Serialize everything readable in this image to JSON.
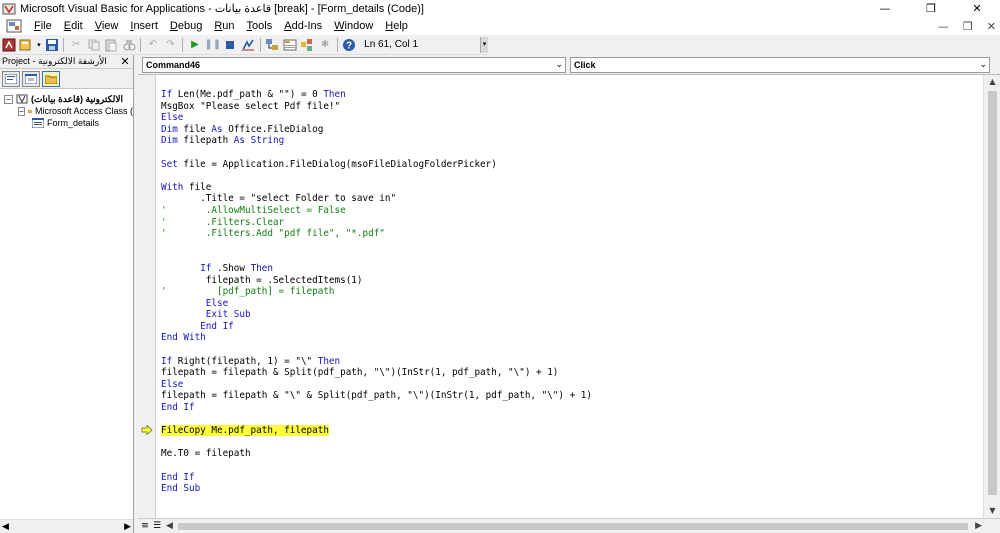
{
  "window": {
    "title": "Microsoft Visual Basic for Applications - قاعدة بيانات [break] - [Form_details (Code)]",
    "minimize": "—",
    "maximize": "❐",
    "close": "✕"
  },
  "menu": {
    "items": [
      {
        "pre": "",
        "u": "F",
        "post": "ile"
      },
      {
        "pre": "",
        "u": "E",
        "post": "dit"
      },
      {
        "pre": "",
        "u": "V",
        "post": "iew"
      },
      {
        "pre": "",
        "u": "I",
        "post": "nsert"
      },
      {
        "pre": "",
        "u": "D",
        "post": "ebug"
      },
      {
        "pre": "",
        "u": "R",
        "post": "un"
      },
      {
        "pre": "",
        "u": "T",
        "post": "ools"
      },
      {
        "pre": "",
        "u": "A",
        "post": "dd-Ins"
      },
      {
        "pre": "",
        "u": "W",
        "post": "indow"
      },
      {
        "pre": "",
        "u": "H",
        "post": "elp"
      }
    ],
    "mdi_minimize": "—",
    "mdi_restore": "❐",
    "mdi_close": "✕"
  },
  "toolbar": {
    "cursor_position": "Ln 61, Col 1"
  },
  "project": {
    "title": "Project - الأرشفة الالكترونية",
    "close": "✕",
    "tree": [
      {
        "label": "الالكترونية (قاعدة بيانات)",
        "level": 0
      },
      {
        "label": "Microsoft Access Class (",
        "level": 1
      },
      {
        "label": "Form_details",
        "level": 2
      }
    ]
  },
  "code_window": {
    "object_combo": "Command46",
    "procedure_combo": "Click",
    "current_line_index": 29,
    "lines": [
      [
        {
          "t": "If",
          "c": "kw"
        },
        {
          "t": " Len(Me.pdf_path & \"\") = 0 "
        },
        {
          "t": "Then",
          "c": "kw"
        }
      ],
      [
        {
          "t": "MsgBox \"Please select Pdf file!\""
        }
      ],
      [
        {
          "t": "Else",
          "c": "kw"
        }
      ],
      [
        {
          "t": "Dim",
          "c": "kw"
        },
        {
          "t": " file "
        },
        {
          "t": "As",
          "c": "kw"
        },
        {
          "t": " Office.FileDialog"
        }
      ],
      [
        {
          "t": "Dim",
          "c": "kw"
        },
        {
          "t": " filepath "
        },
        {
          "t": "As",
          "c": "kw"
        },
        {
          "t": " "
        },
        {
          "t": "String",
          "c": "kw"
        }
      ],
      [],
      [
        {
          "t": "Set",
          "c": "kw"
        },
        {
          "t": " file = Application.FileDialog(msoFileDialogFolderPicker)"
        }
      ],
      [],
      [
        {
          "t": "With",
          "c": "kw"
        },
        {
          "t": " file"
        }
      ],
      [
        {
          "t": "       .Title = \"select Folder to save in\""
        }
      ],
      [
        {
          "t": "'       .AllowMultiSelect = False",
          "c": "cm"
        }
      ],
      [
        {
          "t": "'       .Filters.Clear",
          "c": "cm"
        }
      ],
      [
        {
          "t": "'       .Filters.Add \"pdf file\", \"*.pdf\"",
          "c": "cm"
        }
      ],
      [],
      [],
      [
        {
          "t": "       "
        },
        {
          "t": "If",
          "c": "kw"
        },
        {
          "t": " .Show "
        },
        {
          "t": "Then",
          "c": "kw"
        }
      ],
      [
        {
          "t": "        filepath = .SelectedItems(1)"
        }
      ],
      [
        {
          "t": "'         [pdf_path] = filepath",
          "c": "cm"
        }
      ],
      [
        {
          "t": "        "
        },
        {
          "t": "Else",
          "c": "kw"
        }
      ],
      [
        {
          "t": "        "
        },
        {
          "t": "Exit Sub",
          "c": "kw"
        }
      ],
      [
        {
          "t": "       "
        },
        {
          "t": "End If",
          "c": "kw"
        }
      ],
      [
        {
          "t": "End With",
          "c": "kw"
        }
      ],
      [],
      [
        {
          "t": "If",
          "c": "kw"
        },
        {
          "t": " Right(filepath, 1) = \"\\\" "
        },
        {
          "t": "Then",
          "c": "kw"
        }
      ],
      [
        {
          "t": "filepath = filepath & Split(pdf_path, \"\\\")(InStr(1, pdf_path, \"\\\") + 1)"
        }
      ],
      [
        {
          "t": "Else",
          "c": "kw"
        }
      ],
      [
        {
          "t": "filepath = filepath & \"\\\" & Split(pdf_path, \"\\\")(InStr(1, pdf_path, \"\\\") + 1)"
        }
      ],
      [
        {
          "t": "End If",
          "c": "kw"
        }
      ],
      [],
      [
        {
          "t": "FileCopy Me.pdf_path, filepath",
          "c": "hl"
        }
      ],
      [],
      [
        {
          "t": "Me.T0 = filepath"
        }
      ],
      [],
      [
        {
          "t": "End If",
          "c": "kw"
        }
      ],
      [
        {
          "t": "End Sub",
          "c": "kw"
        }
      ]
    ]
  }
}
